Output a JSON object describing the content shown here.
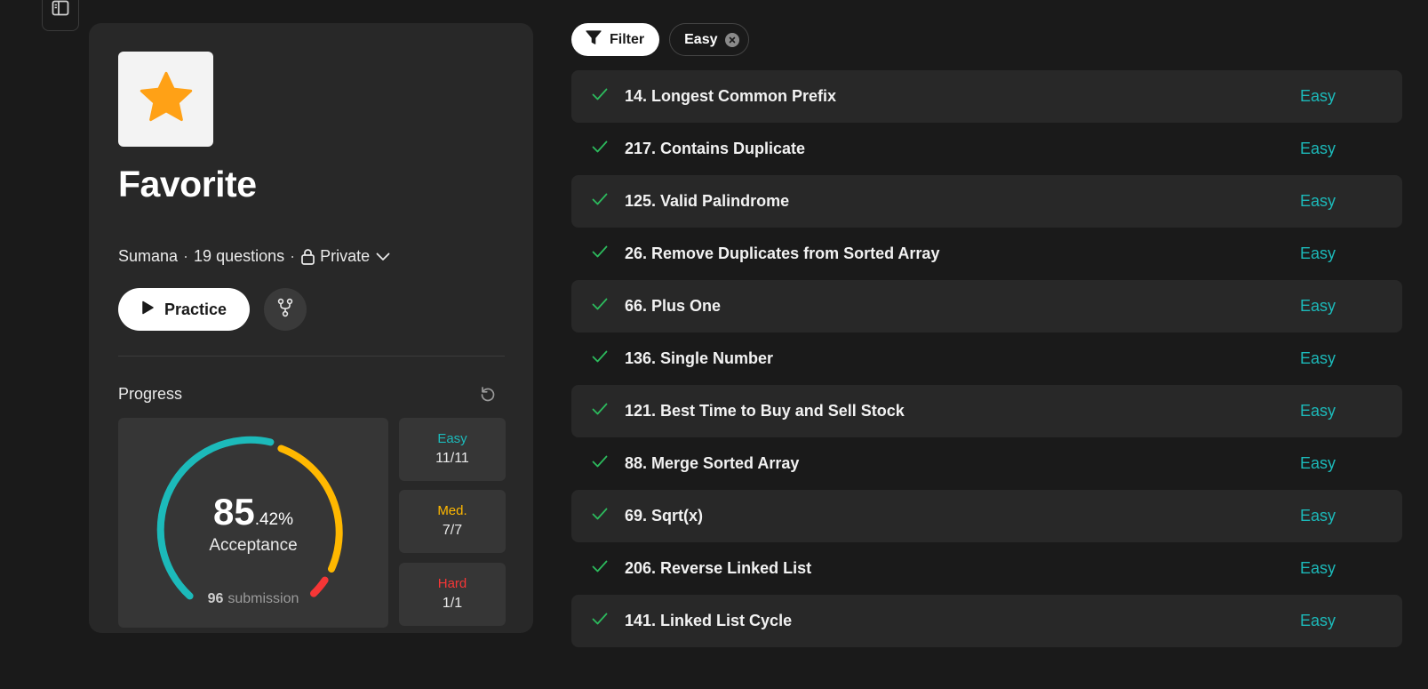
{
  "colors": {
    "background": "#1a1a1a",
    "card": "#282828",
    "easy": "#1cbaba",
    "medium": "#ffb800",
    "hard": "#f63636",
    "check": "#2cbb5d",
    "star": "#ffa116"
  },
  "icons": {
    "sidebar_toggle": "sidebar-toggle-icon",
    "cover": "star-icon",
    "privacy": "lock-icon",
    "privacy_menu": "chevron-down-icon",
    "practice": "play-icon",
    "fork": "fork-icon",
    "reset": "reset-icon",
    "filter": "filter-icon",
    "chip_remove": "close-icon",
    "solved": "check-icon"
  },
  "list": {
    "title": "Favorite",
    "author": "Sumana",
    "separator": "·",
    "question_count": "19 questions",
    "privacy": "Private",
    "practice_label": "Practice"
  },
  "progress": {
    "label": "Progress",
    "acceptance_int": "85",
    "acceptance_dec": ".42%",
    "acceptance_caption": "Acceptance",
    "submissions": "96",
    "submission_label": "submission",
    "difficulties": [
      {
        "name": "Easy",
        "value": "11/11",
        "color": "#1cbaba"
      },
      {
        "name": "Med.",
        "value": "7/7",
        "color": "#ffb800"
      },
      {
        "name": "Hard",
        "value": "1/1",
        "color": "#f63636"
      }
    ]
  },
  "filter": {
    "label": "Filter",
    "chip": "Easy"
  },
  "questions": [
    {
      "title": "14. Longest Common Prefix",
      "difficulty": "Easy"
    },
    {
      "title": "217. Contains Duplicate",
      "difficulty": "Easy"
    },
    {
      "title": "125. Valid Palindrome",
      "difficulty": "Easy"
    },
    {
      "title": "26. Remove Duplicates from Sorted Array",
      "difficulty": "Easy"
    },
    {
      "title": "66. Plus One",
      "difficulty": "Easy"
    },
    {
      "title": "136. Single Number",
      "difficulty": "Easy"
    },
    {
      "title": "121. Best Time to Buy and Sell Stock",
      "difficulty": "Easy"
    },
    {
      "title": "88. Merge Sorted Array",
      "difficulty": "Easy"
    },
    {
      "title": "69. Sqrt(x)",
      "difficulty": "Easy"
    },
    {
      "title": "206. Reverse Linked List",
      "difficulty": "Easy"
    },
    {
      "title": "141. Linked List Cycle",
      "difficulty": "Easy"
    }
  ]
}
